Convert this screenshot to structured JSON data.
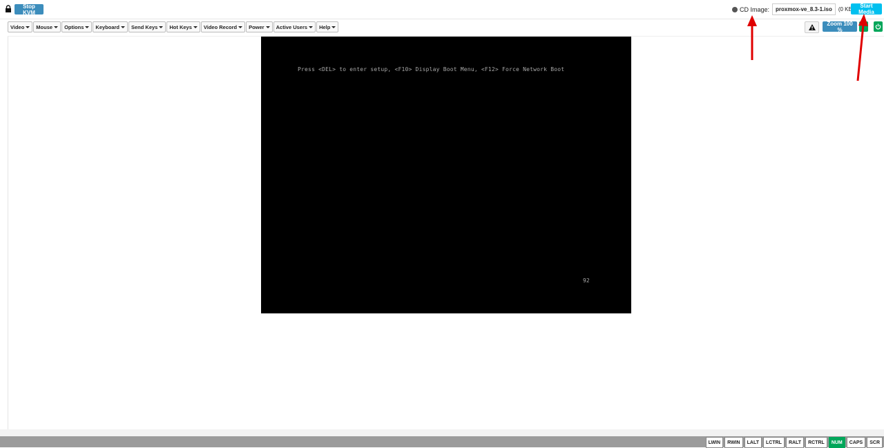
{
  "header": {
    "stop_kvm_label": "Stop KVM",
    "cd_image_label": "CD Image:",
    "cd_image_file": "proxmox-ve_8.3-1.iso",
    "cd_image_size": "(0 KB)",
    "start_media_label": "Start Media"
  },
  "toolbar": {
    "menus": [
      "Video",
      "Mouse",
      "Options",
      "Keyboard",
      "Send Keys",
      "Hot Keys",
      "Video Record",
      "Power",
      "Active Users",
      "Help"
    ],
    "zoom_label": "Zoom 100 %"
  },
  "screen": {
    "boot_message": "Press <DEL> to enter setup, <F10> Display Boot Menu, <F12> Force Network Boot",
    "post_code": "92"
  },
  "statusbar": {
    "keys": [
      {
        "label": "LWIN",
        "active": false
      },
      {
        "label": "RWIN",
        "active": false
      },
      {
        "label": "LALT",
        "active": false
      },
      {
        "label": "LCTRL",
        "active": false
      },
      {
        "label": "RALT",
        "active": false
      },
      {
        "label": "RCTRL",
        "active": false
      },
      {
        "label": "NUM",
        "active": true
      },
      {
        "label": "CAPS",
        "active": false
      },
      {
        "label": "SCR",
        "active": false
      }
    ]
  },
  "colors": {
    "primary": "#3c8dbc",
    "info": "#00c0ef",
    "success": "#00a65a",
    "annotation_arrow": "#e00000"
  },
  "icons": [
    "lock-icon",
    "warning-icon",
    "power-icon",
    "cd-status-icon"
  ]
}
